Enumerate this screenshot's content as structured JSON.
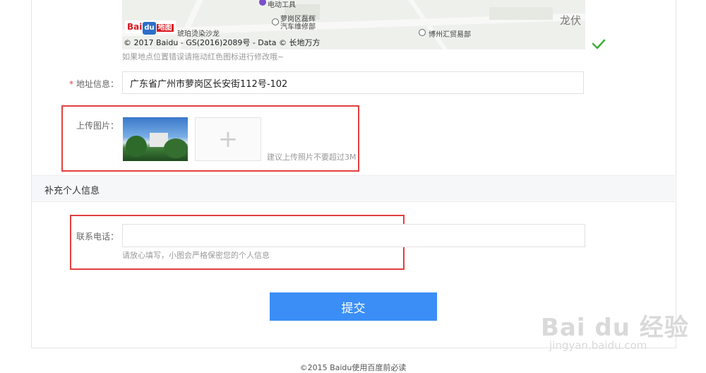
{
  "map": {
    "poi_top": "电动工具",
    "poi_repair": "萝岗区磊辉\n汽车维修部",
    "poi_hupo": "琥珀烫染沙龙",
    "poi_trade": "博州汇贸易部",
    "place_long": "龙伏",
    "logo_bai": "Bai",
    "logo_paw": "du",
    "logo_ditu": "地图",
    "copyright": "© 2017 Baidu - GS(2016)2089号 - Data © 长地万方",
    "hint": "如果地点位置错误请拖动红色图标进行修改哦~",
    "check_color": "#3cb034"
  },
  "address": {
    "required_mark": "*",
    "label": "地址信息：",
    "value": "广东省广州市萝岗区长安街112号-102"
  },
  "upload": {
    "label": "上传图片：",
    "add_symbol": "+",
    "hint": "建议上传照片不要超过3M"
  },
  "section": {
    "title": "补充个人信息"
  },
  "phone": {
    "label": "联系电话：",
    "value": "",
    "hint": "请放心填写，小图会严格保密您的个人信息"
  },
  "submit": {
    "label": "提交",
    "color": "#3a8ef6"
  },
  "watermark": {
    "logo": "Bai du 经验",
    "url": "jingyan.baidu.com"
  },
  "footer": {
    "text": "©2015 Baidu使用百度前必读"
  },
  "colors": {
    "highlight_box": "#e24040",
    "required": "#e54545"
  }
}
